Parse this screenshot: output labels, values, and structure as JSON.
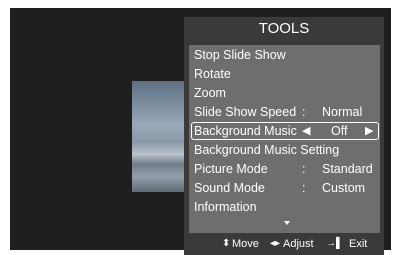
{
  "menu": {
    "title": "TOOLS",
    "items": [
      {
        "label": "Stop Slide Show"
      },
      {
        "label": "Rotate"
      },
      {
        "label": "Zoom"
      },
      {
        "label": "Slide Show Speed",
        "colon": ":",
        "value": "Normal"
      },
      {
        "label": "Background Music",
        "value": "Off",
        "selected": true
      },
      {
        "label": "Background Music Setting"
      },
      {
        "label": "Picture Mode",
        "colon": ":",
        "value": "Standard"
      },
      {
        "label": "Sound Mode",
        "colon": ":",
        "value": "Custom"
      },
      {
        "label": "Information"
      }
    ]
  },
  "footer": {
    "move_label": "Move",
    "adjust_label": "Adjust",
    "exit_label": "Exit"
  },
  "colors": {
    "panel": "#3a3a3a",
    "list": "#6e6e6e",
    "screen": "#1f1f1f"
  }
}
